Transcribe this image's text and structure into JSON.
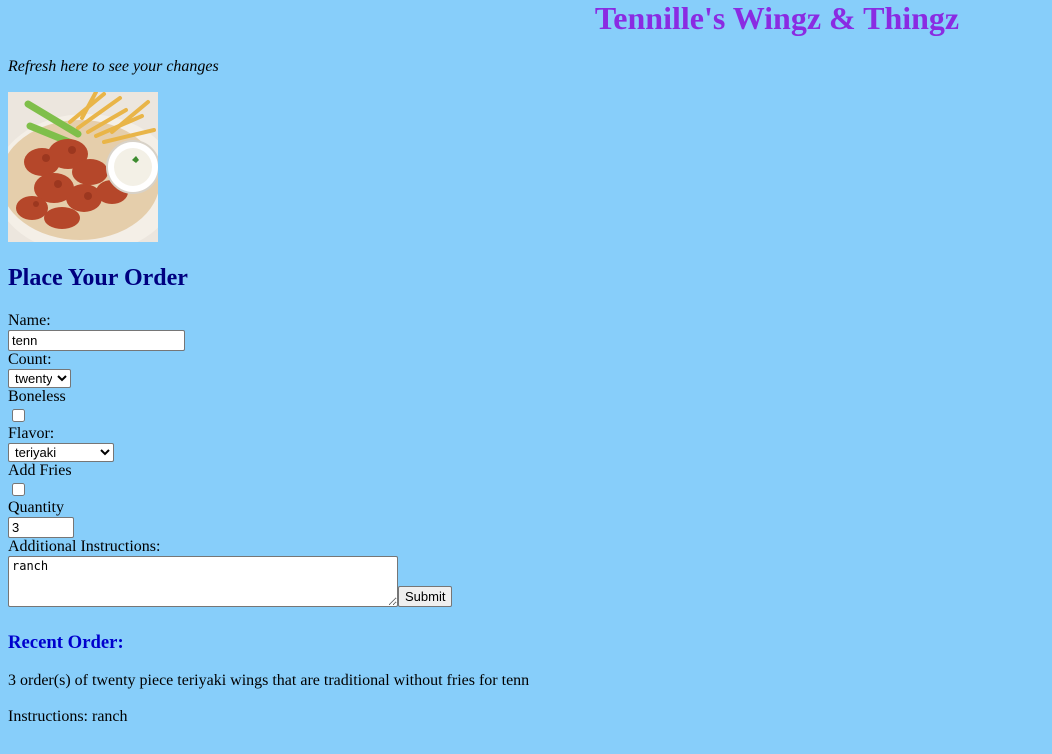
{
  "header": {
    "title": "Tennille's Wingz & Thingz"
  },
  "refresh_note": "Refresh here to see your changes",
  "hero_image": {
    "icon": "wings-fries-ranch-photo"
  },
  "order_form": {
    "heading": "Place Your Order",
    "name_label": "Name:",
    "name_value": "tenn",
    "count_label": "Count:",
    "count_selected": "twenty",
    "boneless_label": "Boneless",
    "boneless_checked": false,
    "flavor_label": "Flavor:",
    "flavor_selected": "teriyaki",
    "fries_label": "Add Fries",
    "fries_checked": false,
    "quantity_label": "Quantity",
    "quantity_value": "3",
    "instructions_label": "Additional Instructions:",
    "instructions_value": "ranch",
    "submit_label": "Submit"
  },
  "recent_order": {
    "heading": "Recent Order:",
    "summary": "3 order(s) of twenty piece teriyaki wings that are traditional without fries for tenn",
    "instructions": "Instructions: ranch"
  },
  "colors": {
    "background": "#87cefa",
    "title": "#8a2be2",
    "order_heading": "#000080",
    "recent_heading": "#0000cd"
  }
}
